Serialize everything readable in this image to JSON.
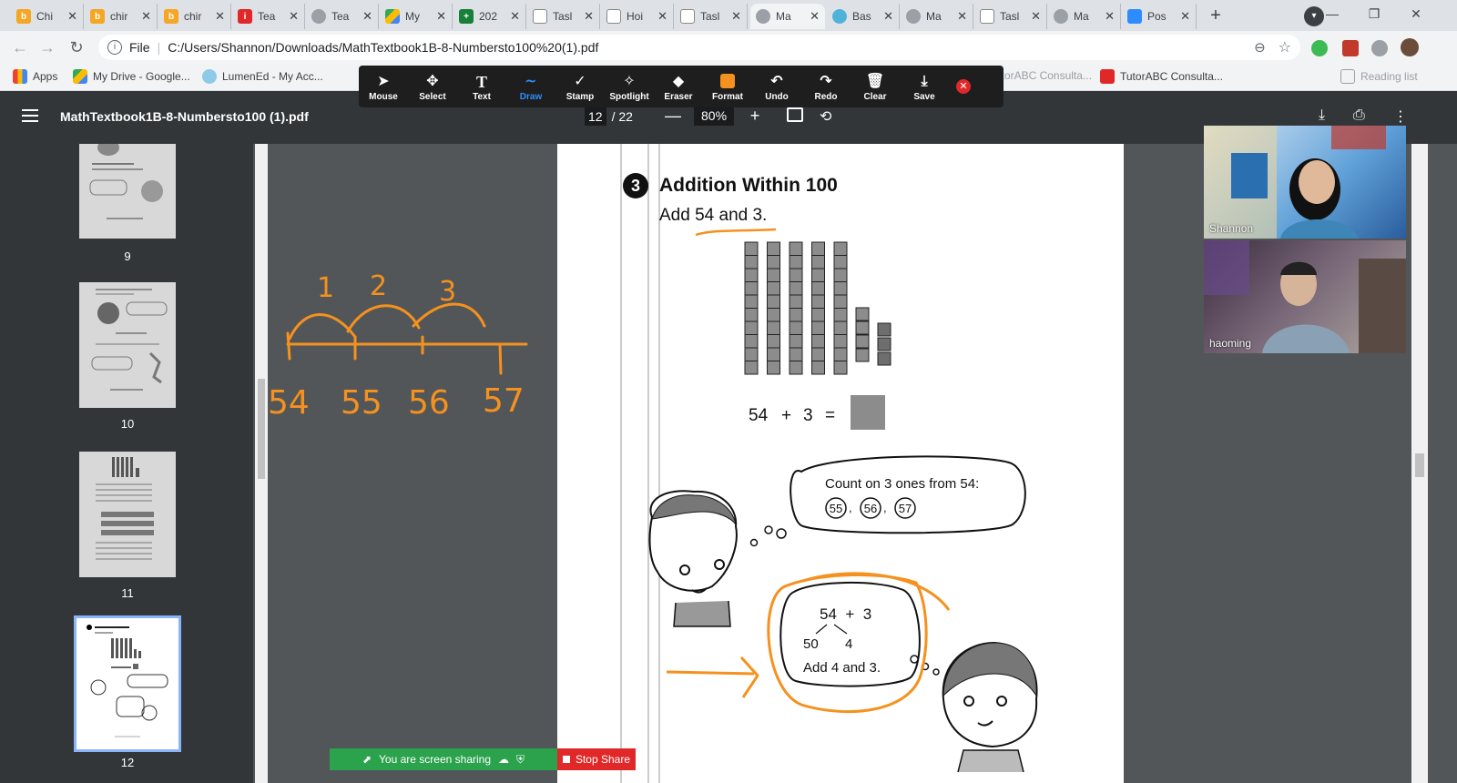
{
  "tabs": [
    {
      "title": "Chi",
      "favicon": "bs"
    },
    {
      "title": "chir",
      "favicon": "bs"
    },
    {
      "title": "chir",
      "favicon": "bs"
    },
    {
      "title": "Tea",
      "favicon": "i"
    },
    {
      "title": "Tea",
      "favicon": "globe"
    },
    {
      "title": "My",
      "favicon": "drive"
    },
    {
      "title": "202",
      "favicon": "plus"
    },
    {
      "title": "Tasl",
      "favicon": "doc"
    },
    {
      "title": "Hoi",
      "favicon": "doc"
    },
    {
      "title": "Tasl",
      "favicon": "doc"
    },
    {
      "title": "Ma",
      "favicon": "globe",
      "active": true
    },
    {
      "title": "Bas",
      "favicon": "owl"
    },
    {
      "title": "Ma",
      "favicon": "globe"
    },
    {
      "title": "Tasl",
      "favicon": "doc"
    },
    {
      "title": "Ma",
      "favicon": "globe"
    },
    {
      "title": "Pos",
      "favicon": "zoom"
    }
  ],
  "address": {
    "scheme": "File",
    "url": "C:/Users/Shannon/Downloads/MathTextbook1B-8-Numbersto100%20(1).pdf"
  },
  "bookmarks": [
    {
      "label": "Apps"
    },
    {
      "label": "My Drive - Google..."
    },
    {
      "label": "LumenEd - My Acc..."
    },
    {
      "label": "TutorABC Consulta..."
    },
    {
      "label": "TutorABC Consulta..."
    },
    {
      "label": "Reading list"
    }
  ],
  "annotation_tools": [
    {
      "label": "Mouse",
      "icon": "cursor-icon"
    },
    {
      "label": "Select",
      "icon": "move-icon"
    },
    {
      "label": "Text",
      "icon": "text-icon"
    },
    {
      "label": "Draw",
      "icon": "draw-icon"
    },
    {
      "label": "Stamp",
      "icon": "check-icon"
    },
    {
      "label": "Spotlight",
      "icon": "spotlight-icon"
    },
    {
      "label": "Eraser",
      "icon": "eraser-icon"
    },
    {
      "label": "Format",
      "icon": "format-icon"
    },
    {
      "label": "Undo",
      "icon": "undo-icon"
    },
    {
      "label": "Redo",
      "icon": "redo-icon"
    },
    {
      "label": "Clear",
      "icon": "trash-icon"
    },
    {
      "label": "Save",
      "icon": "save-icon"
    }
  ],
  "pdf": {
    "title": "MathTextbook1B-8-Numbersto100 (1).pdf",
    "page": "12",
    "total": "/ 22",
    "zoom": "80%"
  },
  "thumbnails": [
    {
      "label": "9"
    },
    {
      "label": "10"
    },
    {
      "label": "11"
    },
    {
      "label": "12"
    }
  ],
  "annotation_drawing": {
    "hops": [
      "1",
      "2",
      "3"
    ],
    "numbers": [
      "54",
      "55",
      "56",
      "57"
    ]
  },
  "textbook": {
    "section_number": "3",
    "heading": "Addition Within 100",
    "prompt": "Add 54 and 3.",
    "equation_left": "54",
    "equation_plus": "+",
    "equation_right": "3",
    "equation_equals": "=",
    "bubble1_text": "Count on 3 ones from 54:",
    "bubble1_circles": [
      "55",
      "56",
      "57"
    ],
    "bubble2_top": "54  +  3",
    "bubble2_left": "50",
    "bubble2_right": "4",
    "bubble2_bottom": "Add 4 and 3."
  },
  "participants": [
    {
      "name": "Shannon"
    },
    {
      "name": "haoming"
    }
  ],
  "share": {
    "status": "You are screen sharing",
    "stop": "Stop Share"
  },
  "colors": {
    "annotation_orange": "#f5911e",
    "active_tool": "#2d8cff",
    "share_green": "#2ba24c",
    "stop_red": "#e02828"
  }
}
